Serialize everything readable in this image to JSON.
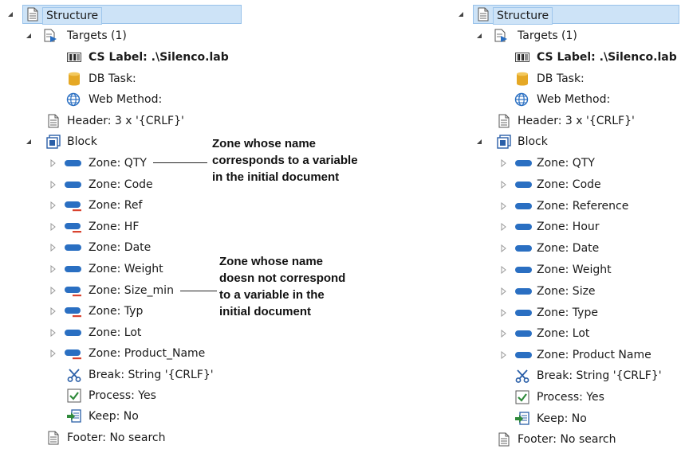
{
  "left_tree": {
    "root": "Structure",
    "targets": "Targets (1)",
    "cs_label_prefix": "CS Label: ",
    "cs_label_value": ".\\Silenco.lab",
    "db_task": "DB Task:",
    "web_method": "Web Method:",
    "header": "Header: 3 x '{CRLF}'",
    "block": "Block",
    "zones": [
      "Zone: QTY",
      "Zone: Code",
      "Zone: Ref",
      "Zone: HF",
      "Zone: Date",
      "Zone: Weight",
      "Zone: Size_min",
      "Zone: Typ",
      "Zone: Lot",
      "Zone: Product_Name"
    ],
    "zone_mismatch": [
      false,
      false,
      true,
      true,
      false,
      false,
      true,
      true,
      false,
      true
    ],
    "break": "Break: String '{CRLF}'",
    "process": "Process: Yes",
    "keep": "Keep: No",
    "footer": "Footer: No search"
  },
  "right_tree": {
    "root": "Structure",
    "targets": "Targets (1)",
    "cs_label_prefix": "CS Label: ",
    "cs_label_value": ".\\Silenco.lab",
    "db_task": "DB Task:",
    "web_method": "Web Method:",
    "header": "Header: 3 x '{CRLF}'",
    "block": "Block",
    "zones": [
      "Zone: QTY",
      "Zone: Code",
      "Zone: Reference",
      "Zone: Hour",
      "Zone: Date",
      "Zone: Weight",
      "Zone: Size",
      "Zone: Type",
      "Zone: Lot",
      "Zone: Product Name"
    ],
    "break": "Break: String '{CRLF}'",
    "process": "Process: Yes",
    "keep": "Keep: No",
    "footer": "Footer: No search"
  },
  "annotations": {
    "match": [
      "Zone whose name",
      "corresponds to a variable",
      "in the initial document"
    ],
    "mismatch": [
      "Zone whose name",
      "doesn not correspond",
      "to a variable in the",
      "initial document"
    ]
  },
  "colors": {
    "selection_bg": "#cde3f7",
    "selection_border": "#98c2ea",
    "zone_blue": "#2a6fc2",
    "zone_red": "#d9432f",
    "db_gold": "#e5a825",
    "check_green": "#2f8a3b"
  }
}
